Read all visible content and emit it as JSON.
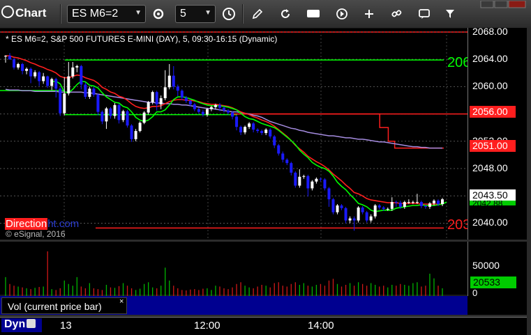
{
  "toolbar": {
    "title": "Chart",
    "symbol": "ES M6=2",
    "interval": "5"
  },
  "chart": {
    "title": "* ES M6=2, S&P 500 FUTURES E-MINI (DAY), 5, 09:30-16:15 (Dynamic)",
    "copyright": "© eSignal, 2016",
    "watermark_a": "Direction",
    "watermark_b": "ht.com",
    "level_labels": {
      "green": "206",
      "red": "203"
    },
    "price_tags": {
      "upper_red": "2056.00",
      "lower_red": "2051.00",
      "last": "2043.50",
      "last_under": "2042.88"
    },
    "colors": {
      "background": "#000000",
      "up": "#ffffff",
      "down": "#1a1aff",
      "ema_fast": "#00ff00",
      "ema_slow": "#ff1e1e",
      "ema_long": "#a58ce0",
      "level_green": "#00ff00",
      "level_red": "#ff1e1e"
    }
  },
  "chart_data": {
    "type": "candlestick",
    "title": "* ES M6=2, S&P 500 FUTURES E-MINI (DAY), 5, 09:30-16:15 (Dynamic)",
    "y_ticks": [
      "2068.00",
      "2064.00",
      "2060.00",
      "2056.00",
      "2052.00",
      "2048.00",
      "2044.00",
      "2040.00"
    ],
    "ylim": [
      2037.5,
      2068.6
    ],
    "x_ticks": [
      "13",
      "12:00",
      "14:00"
    ],
    "levels": [
      {
        "color": "green",
        "value": 2063.9,
        "label": "206"
      },
      {
        "color": "green",
        "value": 2056.1
      },
      {
        "color": "red",
        "value": 2056.0,
        "label": "2056.00"
      },
      {
        "color": "red",
        "value": 2039.3,
        "label": "203"
      }
    ],
    "candles": [
      [
        2064.5,
        2064.5,
        2063.5,
        2064.6
      ],
      [
        2064.5,
        2064,
        2063.9,
        2064.9
      ],
      [
        2064,
        2062.8,
        2062.5,
        2064.2
      ],
      [
        2062.8,
        2063.3,
        2062.5,
        2063.5
      ],
      [
        2063.3,
        2062.3,
        2061.8,
        2063.5
      ],
      [
        2062.3,
        2062.6,
        2061.8,
        2062.8
      ],
      [
        2062.6,
        2061.5,
        2060.5,
        2062.8
      ],
      [
        2061.5,
        2062.1,
        2061.2,
        2062.4
      ],
      [
        2062.1,
        2060.8,
        2060.1,
        2062.3
      ],
      [
        2060.8,
        2061.5,
        2060.4,
        2062
      ],
      [
        2061.5,
        2060.1,
        2059.8,
        2061.6
      ],
      [
        2060.1,
        2061.1,
        2059.5,
        2061.3
      ],
      [
        2061.1,
        2059.7,
        2058.4,
        2061.3
      ],
      [
        2059.7,
        2056.1,
        2055.7,
        2059.9
      ],
      [
        2056.1,
        2059,
        2055.8,
        2061.4
      ],
      [
        2059,
        2061.5,
        2058.7,
        2063.6
      ],
      [
        2061.5,
        2062.8,
        2061.2,
        2063.6
      ],
      [
        2062.8,
        2063,
        2062.1,
        2063.2
      ],
      [
        2063,
        2060.3,
        2059.6,
        2063.2
      ],
      [
        2060.3,
        2058.5,
        2058.2,
        2060.6
      ],
      [
        2058.5,
        2059.7,
        2058.2,
        2060
      ],
      [
        2059.7,
        2058.8,
        2058.5,
        2060
      ],
      [
        2058.8,
        2056.3,
        2055.8,
        2059
      ],
      [
        2056.3,
        2054.9,
        2054.5,
        2056.5
      ],
      [
        2054.9,
        2056.8,
        2053.8,
        2057
      ],
      [
        2056.8,
        2055.7,
        2055.3,
        2057
      ],
      [
        2055.7,
        2057.3,
        2055.3,
        2057.6
      ],
      [
        2057.3,
        2055.1,
        2054.6,
        2057.5
      ],
      [
        2055.1,
        2056.4,
        2054.8,
        2056.6
      ],
      [
        2056.4,
        2054.3,
        2054,
        2056.6
      ],
      [
        2054.3,
        2052.3,
        2051.9,
        2054.5
      ],
      [
        2052.3,
        2053.5,
        2052,
        2053.8
      ],
      [
        2053.5,
        2054.7,
        2053.3,
        2054.9
      ],
      [
        2054.7,
        2056.2,
        2054.5,
        2056.4
      ],
      [
        2056.2,
        2057.7,
        2055.9,
        2057.9
      ],
      [
        2057.7,
        2059.2,
        2057.4,
        2059.4
      ],
      [
        2059.2,
        2057.4,
        2056.5,
        2059.4
      ],
      [
        2057.4,
        2058.3,
        2056.7,
        2058.7
      ],
      [
        2058.3,
        2059.9,
        2058,
        2062.4
      ],
      [
        2059.9,
        2061.6,
        2059.6,
        2063.3
      ],
      [
        2061.6,
        2060,
        2059.6,
        2063
      ],
      [
        2060,
        2059.4,
        2058.6,
        2060.3
      ],
      [
        2059.4,
        2058.4,
        2058,
        2059.6
      ],
      [
        2058.4,
        2057.9,
        2057.6,
        2058.6
      ],
      [
        2057.9,
        2057.4,
        2057.1,
        2058.1
      ],
      [
        2057.4,
        2056.7,
        2056.4,
        2057.6
      ],
      [
        2056.7,
        2056.3,
        2056,
        2056.9
      ],
      [
        2056.3,
        2055.9,
        2055.6,
        2056.6
      ],
      [
        2055.9,
        2056.7,
        2055.6,
        2056.9
      ],
      [
        2056.7,
        2057,
        2056.4,
        2057.2
      ],
      [
        2057,
        2057.3,
        2056.7,
        2057.5
      ],
      [
        2057.3,
        2056.9,
        2056.4,
        2057.6
      ],
      [
        2056.9,
        2056.5,
        2056.2,
        2057.1
      ],
      [
        2056.5,
        2056.2,
        2055.9,
        2056.7
      ],
      [
        2056.2,
        2055.6,
        2055.2,
        2056.4
      ],
      [
        2055.6,
        2054.1,
        2053.6,
        2055.8
      ],
      [
        2054.1,
        2053.3,
        2052.9,
        2054.3
      ],
      [
        2053.3,
        2054.1,
        2053,
        2054.3
      ],
      [
        2054.1,
        2054.6,
        2053.8,
        2054.8
      ],
      [
        2054.6,
        2053.7,
        2053.3,
        2054.8
      ],
      [
        2053.7,
        2053.5,
        2053.2,
        2053.9
      ],
      [
        2053.5,
        2053.2,
        2052.9,
        2053.7
      ],
      [
        2053.2,
        2053.7,
        2052.9,
        2053.9
      ],
      [
        2053.7,
        2052.7,
        2052.4,
        2053.9
      ],
      [
        2052.7,
        2051.4,
        2051,
        2052.9
      ],
      [
        2051.4,
        2050.2,
        2049.9,
        2051.6
      ],
      [
        2050.2,
        2049.3,
        2048.9,
        2050.5
      ],
      [
        2049.3,
        2048.8,
        2048.5,
        2049.5
      ],
      [
        2048.8,
        2047.4,
        2047,
        2049
      ],
      [
        2047.4,
        2045.5,
        2045.2,
        2047.6
      ],
      [
        2045.5,
        2046.8,
        2045.2,
        2047.9
      ],
      [
        2046.8,
        2046.9,
        2046.5,
        2047.1
      ],
      [
        2046.9,
        2045.1,
        2043.9,
        2047.1
      ],
      [
        2045.1,
        2046.1,
        2044.8,
        2046.3
      ],
      [
        2046.1,
        2046.5,
        2045.8,
        2046.7
      ],
      [
        2046.5,
        2046.4,
        2046.1,
        2046.7
      ],
      [
        2046.4,
        2045.1,
        2044.8,
        2046.6
      ],
      [
        2045.1,
        2043.5,
        2042.4,
        2045.3
      ],
      [
        2043.5,
        2041.6,
        2041.3,
        2043.7
      ],
      [
        2041.6,
        2042.6,
        2041.3,
        2042.8
      ],
      [
        2042.6,
        2042.2,
        2041.9,
        2042.8
      ],
      [
        2042.2,
        2040.4,
        2040,
        2042.4
      ],
      [
        2040.4,
        2040.7,
        2040,
        2041
      ],
      [
        2040.7,
        2040.4,
        2038.9,
        2041
      ],
      [
        2040.4,
        2042.3,
        2040.1,
        2042.5
      ],
      [
        2042.3,
        2041.6,
        2041.3,
        2042.5
      ],
      [
        2041.6,
        2040.4,
        2040.1,
        2041.8
      ],
      [
        2040.4,
        2041,
        2040.1,
        2041.3
      ],
      [
        2041,
        2042.6,
        2040.7,
        2042.8
      ],
      [
        2042.6,
        2042.3,
        2042,
        2042.8
      ],
      [
        2042.3,
        2042.1,
        2041.8,
        2042.5
      ],
      [
        2042.1,
        2042.1,
        2041.8,
        2042.3
      ],
      [
        2042.1,
        2043.1,
        2041.8,
        2043.8
      ],
      [
        2043.1,
        2043,
        2042.4,
        2043.3
      ],
      [
        2043,
        2042.4,
        2042.1,
        2043.3
      ],
      [
        2042.4,
        2043.1,
        2042.1,
        2043.3
      ],
      [
        2043.1,
        2043.1,
        2042.8,
        2043.5
      ],
      [
        2043.1,
        2043.1,
        2042.8,
        2043.3
      ],
      [
        2043.1,
        2043.1,
        2042.8,
        2044.3
      ],
      [
        2043.1,
        2042.5,
        2042.2,
        2043.3
      ],
      [
        2042.5,
        2042.4,
        2042.1,
        2042.7
      ],
      [
        2042.4,
        2042.9,
        2042.1,
        2043.1
      ],
      [
        2042.9,
        2043.3,
        2042.6,
        2043.5
      ],
      [
        2043.3,
        2042.8,
        2042.5,
        2043.5
      ],
      [
        2042.8,
        2043.5,
        2042.5,
        2043.7
      ]
    ],
    "ema_fast": {
      "start": 11,
      "values": [
        2060.7,
        2060.8,
        2060.4,
        2059.2,
        2059.1,
        2059.6,
        2060.3,
        2060.8,
        2060.7,
        2060.2,
        2060.1,
        2059.8,
        2059.1,
        2058.5,
        2058.1,
        2057.7,
        2057.6,
        2057.1,
        2056.9,
        2056.3,
        2055.5,
        2055.1,
        2054.9,
        2055.1,
        2055.6,
        2056.3,
        2056.3,
        2056.6,
        2057.3,
        2058.1,
        2058.5,
        2058.5,
        2058.4,
        2058.2,
        2058,
        2057.7,
        2057.5,
        2057.3,
        2057.2,
        2057.2,
        2057.2,
        2057.1,
        2057,
        2056.8,
        2056.6,
        2056.1,
        2055.6,
        2055.3,
        2055.2,
        2054.9,
        2054.6,
        2054.4,
        2054.2,
        2054,
        2053.6,
        2053.1,
        2052.6,
        2052.1,
        2051.5,
        2050.7,
        2050.1,
        2049.6,
        2048.9,
        2048.5,
        2048.2,
        2048,
        2047.6,
        2046.9,
        2046,
        2045.4,
        2044.9,
        2044.2,
        2043.6,
        2042.9,
        2042.7,
        2042.4,
        2041.9,
        2041.7,
        2041.8,
        2041.9,
        2041.9,
        2041.9,
        2042.2,
        2042.3,
        2042.4,
        2042.5,
        2042.6,
        2042.6,
        2042.7,
        2042.6,
        2042.6,
        2042.6,
        2042.7,
        2042.8,
        2043.1
      ]
    },
    "ema_slow": {
      "start": 0,
      "values": [
        2064.5,
        2064.5,
        2064.3,
        2064.2,
        2064,
        2063.8,
        2063.5,
        2063.3,
        2063,
        2062.8,
        2062.5,
        2062.3,
        2062,
        2061.5,
        2061.3,
        2061.3,
        2061.5,
        2061.7,
        2061.6,
        2061.3,
        2061.1,
        2060.9,
        2060.5,
        2059.9,
        2059.6,
        2059.2,
        2059,
        2058.6,
        2058.4,
        2058,
        2057.5,
        2057.1,
        2056.9,
        2056.8,
        2056.9,
        2057.1,
        2057.1,
        2057.2,
        2057.5,
        2057.8,
        2058,
        2058.1,
        2058.1,
        2058,
        2058,
        2057.9,
        2057.8,
        2057.6,
        2057.5,
        2057.4,
        2057.4,
        2057.3,
        2057.2,
        2057.1,
        2056.9,
        2056.6,
        2056.3,
        2056.1,
        2055.9,
        2055.6,
        2055.4,
        2055.1,
        2054.9,
        2054.6,
        2054.2,
        2053.7,
        2053.2,
        2052.7,
        2052.1,
        2051.4,
        2050.9,
        2050.4,
        2049.8,
        2049.4,
        2049,
        2048.7,
        2048.3,
        2047.8,
        2047.2,
        2046.7,
        2046.2,
        2045.6,
        2045.1,
        2044.5,
        2044.3,
        2044,
        2043.6,
        2043.4,
        2043.3,
        2043.2,
        2043.1,
        2043,
        2043,
        2043,
        2042.9,
        2042.9,
        2042.9,
        2042.9,
        2042.9,
        2042.8,
        2042.8,
        2042.8,
        2042.8,
        2042.8,
        2042.8
      ]
    },
    "ema_long": {
      "start": 0,
      "values": [
        2059.6,
        2059.5,
        2059.5,
        2059.5,
        2059.4,
        2059.4,
        2059.4,
        2059.3,
        2059.3,
        2059.3,
        2059.3,
        2059.3,
        2059.3,
        2059.2,
        2059.2,
        2059.2,
        2059.2,
        2059.2,
        2059.2,
        2059.1,
        2059.1,
        2059,
        2058.9,
        2058.8,
        2058.7,
        2058.6,
        2058.5,
        2058.4,
        2058.3,
        2058.2,
        2058.1,
        2058,
        2057.9,
        2057.8,
        2057.7,
        2057.7,
        2057.6,
        2057.6,
        2057.5,
        2057.5,
        2057.4,
        2057.4,
        2057.3,
        2057.3,
        2057.2,
        2057.1,
        2057,
        2056.9,
        2056.8,
        2056.8,
        2056.7,
        2056.6,
        2056.5,
        2056.4,
        2056.3,
        2056.3,
        2056.2,
        2056.1,
        2056,
        2055.8,
        2055.7,
        2055.5,
        2055.2,
        2054.9,
        2054.7,
        2054.5,
        2054.3,
        2054.1,
        2053.9,
        2053.8,
        2053.6,
        2053.5,
        2053.3,
        2053.2,
        2053.1,
        2053,
        2052.9,
        2052.8,
        2052.8,
        2052.7,
        2052.6,
        2052.5,
        2052.5,
        2052.4,
        2052.3,
        2052.3,
        2052.2,
        2052.1,
        2052,
        2051.9,
        2051.9,
        2051.8,
        2051.7,
        2051.6,
        2051.5,
        2051.4,
        2051.3,
        2051.2,
        2051.2,
        2051.1,
        2051.1,
        2051,
        2051,
        2051,
        2051
      ]
    },
    "red_step": [
      {
        "from": 0.0,
        "to": 0.7,
        "value": 2056.0
      },
      {
        "from": 0.7,
        "to": 0.74,
        "value": 2054.0
      },
      {
        "from": 0.74,
        "to": 0.77,
        "value": 2052.0
      },
      {
        "from": 0.77,
        "to": 1.0,
        "value": 2051.0
      }
    ],
    "volume": {
      "y_ticks": [
        "50000",
        "0"
      ],
      "last": "20533",
      "label": "Vol (current price bar)",
      "values": [
        22000,
        14000,
        12000,
        11000,
        10000,
        9000,
        8000,
        9500,
        10500,
        11000,
        52000,
        8000,
        7000,
        9000,
        18000,
        14000,
        12000,
        22000,
        11000,
        9000,
        15000,
        9000,
        8000,
        7000,
        13000,
        10000,
        9500,
        11500,
        15000,
        12000,
        9000,
        7000,
        8500,
        14000,
        16000,
        10000,
        9000,
        12000,
        33000,
        18000,
        12000,
        9000,
        7000,
        6500,
        7500,
        8000,
        7000,
        8500,
        9000,
        7000,
        12000,
        11000,
        9000,
        8000,
        10000,
        14000,
        16000,
        12000,
        10000,
        9000,
        11000,
        13000,
        12000,
        10000,
        15000,
        16000,
        12000,
        11000,
        14000,
        16000,
        13000,
        15000,
        12000,
        11000,
        13000,
        14000,
        12000,
        18000,
        20000,
        14000,
        11000,
        13000,
        15000,
        12000,
        16000,
        14000,
        12000,
        15000,
        13000,
        11000,
        12000,
        10000,
        13000,
        12000,
        14000,
        13000,
        12000,
        15000,
        16000,
        11000,
        12000,
        26000,
        20533,
        12000,
        9000
      ],
      "ylim": [
        0,
        60000
      ]
    }
  }
}
